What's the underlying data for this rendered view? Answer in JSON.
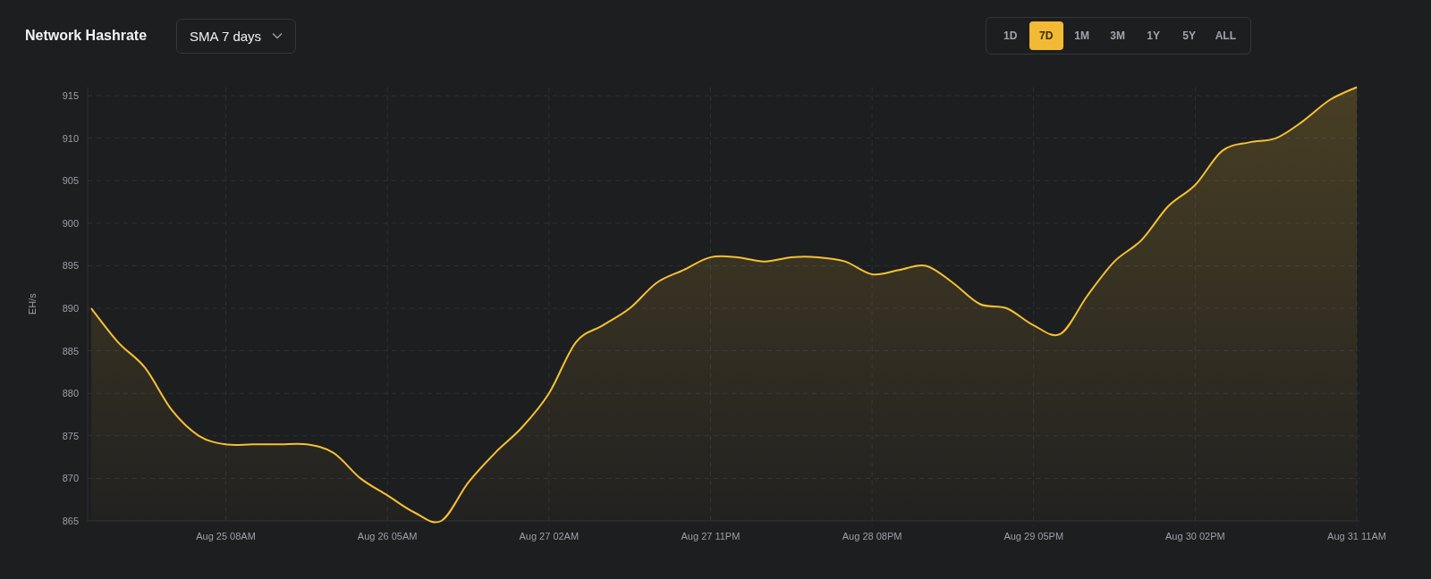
{
  "title": "Network Hashrate",
  "average_select": {
    "value": "SMA 7 days"
  },
  "ranges": [
    {
      "label": "1D",
      "selected": false
    },
    {
      "label": "7D",
      "selected": true
    },
    {
      "label": "1M",
      "selected": false
    },
    {
      "label": "3M",
      "selected": false
    },
    {
      "label": "1Y",
      "selected": false
    },
    {
      "label": "5Y",
      "selected": false
    },
    {
      "label": "ALL",
      "selected": false
    }
  ],
  "chart_data": {
    "type": "area",
    "ylabel": "EH/s",
    "grid": true,
    "categories": [
      null,
      null,
      null,
      null,
      null,
      "Aug 25 08AM",
      null,
      null,
      null,
      null,
      null,
      "Aug 26 05AM",
      null,
      null,
      null,
      null,
      null,
      "Aug 27 02AM",
      null,
      null,
      null,
      null,
      null,
      "Aug 27 11PM",
      null,
      null,
      null,
      null,
      null,
      "Aug 28 08PM",
      null,
      null,
      null,
      null,
      null,
      "Aug 29 05PM",
      null,
      null,
      null,
      null,
      null,
      "Aug 30 02PM",
      null,
      null,
      null,
      null,
      null,
      "Aug 31 11AM"
    ],
    "series": [
      {
        "color": "#f5c033",
        "values": [
          890,
          886,
          883,
          878,
          875,
          874,
          874,
          874,
          874,
          873,
          870,
          868,
          866,
          865,
          869.5,
          873,
          876,
          880,
          886,
          888,
          890,
          893,
          894.5,
          896,
          896,
          895.5,
          896,
          896,
          895.5,
          894,
          894.5,
          895,
          893,
          890.5,
          890,
          888,
          887,
          891.5,
          895.5,
          898,
          902,
          904.5,
          908.5,
          909.5,
          910,
          912,
          914.5,
          916
        ]
      }
    ],
    "ylim": [
      865,
      916
    ],
    "yticks": [
      865,
      870,
      875,
      880,
      885,
      890,
      895,
      900,
      905,
      910,
      915
    ]
  }
}
